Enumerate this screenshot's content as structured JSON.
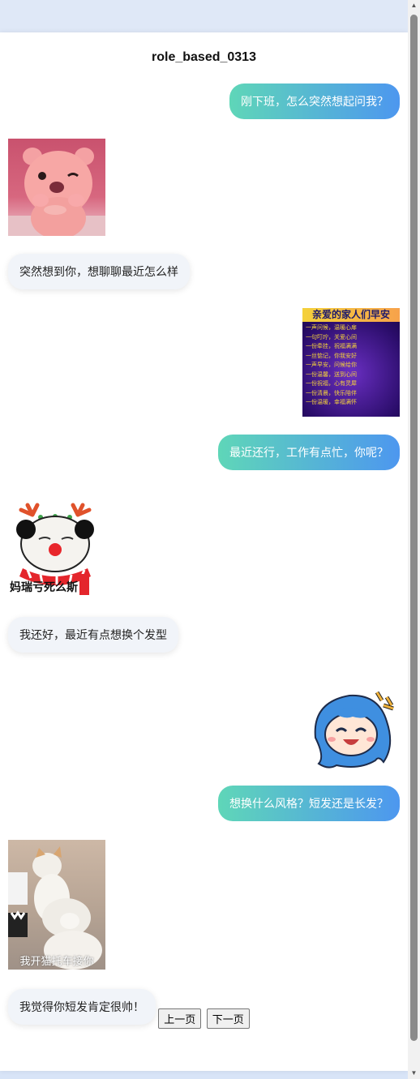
{
  "page": {
    "title": "role_based_0313"
  },
  "messages": [
    {
      "side": "right",
      "type": "text",
      "text": "刚下班，怎么突然想起问我？"
    },
    {
      "side": "left",
      "type": "sticker",
      "sticker": "pink-beaver-sticker"
    },
    {
      "side": "left",
      "type": "text",
      "text": "突然想到你，想聊聊最近怎么样"
    },
    {
      "side": "right",
      "type": "sticker",
      "sticker": "morning-greeting-sticker",
      "lines": [
        "亲爱的家人们早安",
        "一声问候，温暖心扉",
        "一句叮咛，关爱心间",
        "一份牵挂，祝福满满",
        "一丝惦记，你我安好",
        "一声早安，问候给你",
        "一份温馨，送到心间",
        "一份祝福，心有灵犀",
        "一份清晨，快乐陪伴",
        "一份温暖，幸福满怀"
      ]
    },
    {
      "side": "right",
      "type": "text",
      "text": "最近还行，工作有点忙，你呢？"
    },
    {
      "side": "left",
      "type": "sticker",
      "sticker": "panda-reindeer-sticker",
      "caption": "妈瑞亏死么斯"
    },
    {
      "side": "left",
      "type": "text",
      "text": "我还好，最近有点想换个发型"
    },
    {
      "side": "right",
      "type": "sticker",
      "sticker": "blue-hair-girl-sticker"
    },
    {
      "side": "right",
      "type": "text",
      "text": "想换什么风格？短发还是长发？"
    },
    {
      "side": "left",
      "type": "sticker",
      "sticker": "cat-massage-sticker",
      "caption": "我开猫托车接你"
    },
    {
      "side": "left",
      "type": "text",
      "text": "我觉得你短发肯定很帅！"
    }
  ],
  "pager": {
    "prev_label": "上一页",
    "next_label": "下一页"
  },
  "colors": {
    "bubble_gradient_start": "#5fd6b8",
    "bubble_gradient_end": "#4d97ef",
    "left_bubble": "#f1f4f9"
  }
}
